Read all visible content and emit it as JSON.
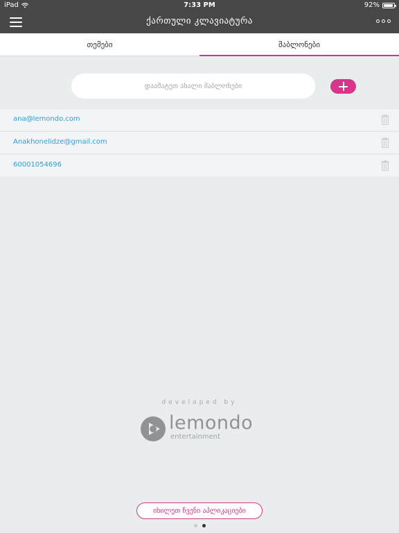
{
  "status_bar": {
    "device": "iPad",
    "time": "7:33 PM",
    "battery_text": "92%",
    "battery_level": 0.92,
    "icons": [
      "wifi-icon",
      "battery-icon"
    ]
  },
  "navbar": {
    "title": "ქართული კლავიატურა",
    "menu_icon": "hamburger-icon",
    "more_icon": "more-dots-icon"
  },
  "tabs": [
    {
      "label": "თემები",
      "active": false
    },
    {
      "label": "შაბლონები",
      "active": true
    }
  ],
  "add_template": {
    "placeholder": "დაამატეთ ახალი შაბლონები",
    "button_icon": "plus-icon"
  },
  "templates": [
    {
      "text": "ana@lemondo.com",
      "icon": "trash-icon"
    },
    {
      "text": "Anakhonelidze@gmail.com",
      "icon": "trash-icon"
    },
    {
      "text": "60001054696",
      "icon": "trash-icon"
    }
  ],
  "footer": {
    "developed_by": "developed by",
    "brand_name": "lemondo",
    "brand_sub": "entertainment",
    "apps_button": "იხილეთ ჩვენი აპლიკაციები"
  },
  "pagination": {
    "total": 2,
    "current": 2
  },
  "colors": {
    "accent": "#d8348a",
    "header_bg": "#474747",
    "link": "#2c9fd8",
    "background": "#e9edee"
  }
}
